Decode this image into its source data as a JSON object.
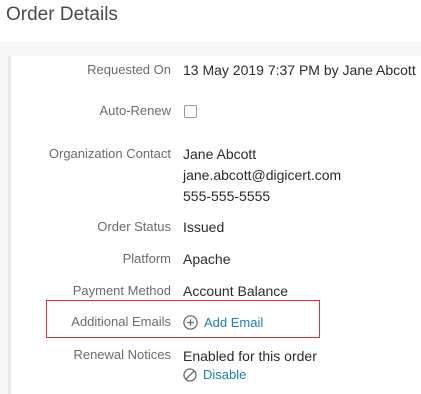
{
  "page": {
    "title": "Order Details"
  },
  "details": {
    "requested_on": {
      "label": "Requested On",
      "value": "13 May 2019 7:37 PM by Jane Abcott"
    },
    "auto_renew": {
      "label": "Auto-Renew",
      "checked": false
    },
    "organization_contact": {
      "label": "Organization Contact",
      "name": "Jane Abcott",
      "email": "jane.abcott@digicert.com",
      "phone": "555-555-5555"
    },
    "order_status": {
      "label": "Order Status",
      "value": "Issued"
    },
    "platform": {
      "label": "Platform",
      "value": "Apache"
    },
    "payment_method": {
      "label": "Payment Method",
      "value": "Account Balance"
    },
    "additional_emails": {
      "label": "Additional Emails",
      "add_label": "Add Email"
    },
    "renewal_notices": {
      "label": "Renewal Notices",
      "value": "Enabled for this order",
      "action_label": "Disable"
    }
  },
  "colors": {
    "link": "#1a7fb5",
    "highlight": "#d9322c"
  },
  "icons": {
    "add": "plus-circle-icon",
    "disable": "ban-icon"
  }
}
